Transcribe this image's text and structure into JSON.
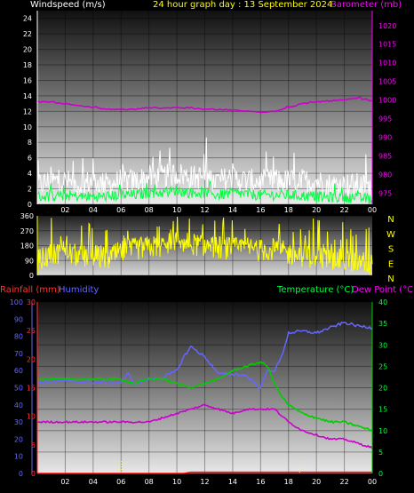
{
  "header": {
    "left": "Windspeed (m/s)",
    "center": "24 hour graph day : 13 September 2024",
    "right": "Barometer (mb)"
  },
  "bottom_header": {
    "rainfall": "Rainfall (mm)",
    "humidity": "Humidity",
    "temperature": "Temperature (°C)",
    "dewpoint": "Dew Point (°C)"
  },
  "colors": {
    "wind_gust": "#ffffff",
    "wind_avg": "#00ff40",
    "barometer": "#cc00cc",
    "direction": "#ffff00",
    "rain": "#ff0000",
    "humidity": "#6666ff",
    "temperature": "#00cc00",
    "dewpoint": "#cc00cc",
    "label_white": "#ffffff",
    "label_yellow": "#ffff00",
    "label_magenta": "#ff00ff"
  },
  "chart_data": [
    {
      "type": "line",
      "name": "wind-barometer",
      "x_tick_labels": [
        "02",
        "04",
        "06",
        "08",
        "10",
        "12",
        "14",
        "16",
        "18",
        "20",
        "22",
        "00"
      ],
      "y_left": {
        "label": "Windspeed (m/s)",
        "ylim": [
          0,
          25
        ],
        "ticks": [
          "0",
          "2",
          "4",
          "6",
          "8",
          "10",
          "12",
          "14",
          "16",
          "18",
          "20",
          "22",
          "24"
        ]
      },
      "y_right": {
        "label": "Barometer (mb)",
        "ylim": [
          972,
          1024
        ],
        "ticks": [
          "975",
          "980",
          "985",
          "990",
          "995",
          "1000",
          "1005",
          "1010",
          "1015",
          "1020"
        ]
      },
      "grid": true,
      "series": [
        {
          "name": "gust",
          "axis": "left",
          "hours": [
            0,
            1,
            2,
            3,
            4,
            5,
            6,
            7,
            8,
            9,
            10,
            11,
            12,
            13,
            14,
            15,
            16,
            17,
            18,
            19,
            20,
            21,
            22,
            23,
            24
          ],
          "values": [
            2.5,
            3,
            3,
            2.5,
            3,
            2.5,
            3,
            3,
            3.5,
            3.5,
            4,
            3.5,
            3.5,
            3,
            3.5,
            3,
            3,
            3,
            3,
            3,
            3,
            2.5,
            2.5,
            2.5,
            2
          ]
        },
        {
          "name": "average",
          "axis": "left",
          "hours": [
            0,
            1,
            2,
            3,
            4,
            5,
            6,
            7,
            8,
            9,
            10,
            11,
            12,
            13,
            14,
            15,
            16,
            17,
            18,
            19,
            20,
            21,
            22,
            23,
            24
          ],
          "values": [
            1,
            1,
            1.2,
            1,
            1,
            1,
            1.2,
            1.2,
            1.5,
            1.5,
            1.8,
            1.5,
            1.5,
            1.2,
            1.5,
            1.3,
            1.2,
            1.2,
            1.2,
            1.1,
            1,
            0.9,
            0.9,
            0.8,
            0.7
          ]
        },
        {
          "name": "barometer",
          "axis": "right",
          "hours": [
            0,
            1,
            2,
            3,
            4,
            5,
            6,
            7,
            8,
            9,
            10,
            11,
            12,
            13,
            14,
            15,
            16,
            17,
            18,
            19,
            20,
            21,
            22,
            23,
            24
          ],
          "values": [
            999.5,
            999.5,
            999,
            998.5,
            998,
            997.5,
            997.5,
            997.5,
            998,
            997.8,
            998,
            997.8,
            997.5,
            997.5,
            997.3,
            997,
            996.8,
            997,
            998,
            999,
            999.5,
            999.8,
            1000,
            1000.5,
            999.8
          ]
        }
      ]
    },
    {
      "type": "line",
      "name": "wind-direction",
      "x_tick_labels": [],
      "y": {
        "ylim": [
          0,
          360
        ],
        "ticks": [
          "0",
          "90",
          "180",
          "270",
          "360"
        ]
      },
      "direction_labels": [
        "N",
        "W",
        "S",
        "E",
        "N"
      ],
      "grid": true,
      "series": [
        {
          "name": "direction",
          "hours": [
            0,
            1,
            2,
            3,
            4,
            5,
            6,
            7,
            8,
            9,
            10,
            11,
            12,
            13,
            14,
            15,
            16,
            17,
            18,
            19,
            20,
            21,
            22,
            23,
            24
          ],
          "values": [
            90,
            120,
            150,
            110,
            120,
            100,
            140,
            160,
            170,
            180,
            200,
            190,
            180,
            170,
            160,
            170,
            150,
            160,
            130,
            120,
            110,
            100,
            90,
            80,
            70
          ]
        }
      ]
    },
    {
      "type": "line",
      "name": "rain-humidity-temperature",
      "x_tick_labels": [
        "02",
        "04",
        "06",
        "08",
        "10",
        "12",
        "14",
        "16",
        "18",
        "20",
        "22",
        "00"
      ],
      "y_left_outer": {
        "label": "Humidity",
        "ylim": [
          0,
          100
        ],
        "ticks": [
          "0",
          "10",
          "20",
          "30",
          "40",
          "50",
          "60",
          "70",
          "80",
          "90",
          "100"
        ]
      },
      "y_left_inner": {
        "label": "Rainfall (mm)",
        "ylim": [
          0,
          30
        ],
        "ticks": [
          "0",
          "5",
          "10",
          "15",
          "20",
          "25",
          "30"
        ]
      },
      "y_right": {
        "label": "Temperature (°C)",
        "ylim": [
          0,
          40
        ],
        "ticks": [
          "0",
          "5",
          "10",
          "15",
          "20",
          "25",
          "30",
          "35",
          "40"
        ]
      },
      "grid": true,
      "series": [
        {
          "name": "rain",
          "axis": "left_inner",
          "hours": [
            0,
            10.7,
            10.8,
            24
          ],
          "values": [
            0,
            0,
            0.2,
            0.2
          ]
        },
        {
          "name": "humidity",
          "axis": "left_outer",
          "hours": [
            0,
            2,
            4,
            6,
            6.5,
            7,
            8,
            9,
            10,
            10.5,
            11,
            12,
            13,
            14,
            15,
            15.5,
            16,
            16.5,
            17,
            17.5,
            18,
            19,
            20,
            21,
            22,
            23,
            24
          ],
          "values": [
            53,
            54,
            53,
            53,
            58,
            52,
            55,
            56,
            60,
            68,
            74,
            68,
            58,
            58,
            57,
            53,
            50,
            60,
            60,
            68,
            82,
            83,
            82,
            85,
            88,
            86,
            85
          ]
        },
        {
          "name": "temperature",
          "axis": "right",
          "hours": [
            0,
            2,
            4,
            6,
            7,
            8,
            9,
            10,
            11,
            12,
            13,
            14,
            15,
            16,
            16.5,
            17,
            17.5,
            18,
            19,
            20,
            21,
            22,
            23,
            24
          ],
          "values": [
            22,
            22,
            22,
            22,
            21,
            22,
            22,
            21,
            20,
            21,
            22,
            24,
            25,
            26,
            25,
            21,
            18,
            16,
            14,
            13,
            12,
            12,
            11,
            10
          ]
        },
        {
          "name": "dewpoint",
          "axis": "right",
          "hours": [
            0,
            2,
            4,
            6,
            8,
            9,
            10,
            11,
            12,
            13,
            14,
            15,
            16,
            17,
            18,
            19,
            20,
            21,
            22,
            23,
            24
          ],
          "values": [
            12,
            12,
            12,
            12,
            12,
            13,
            14,
            15,
            16,
            15,
            14,
            15,
            15,
            15,
            12,
            10,
            9,
            8,
            8,
            7,
            6
          ]
        }
      ]
    }
  ]
}
